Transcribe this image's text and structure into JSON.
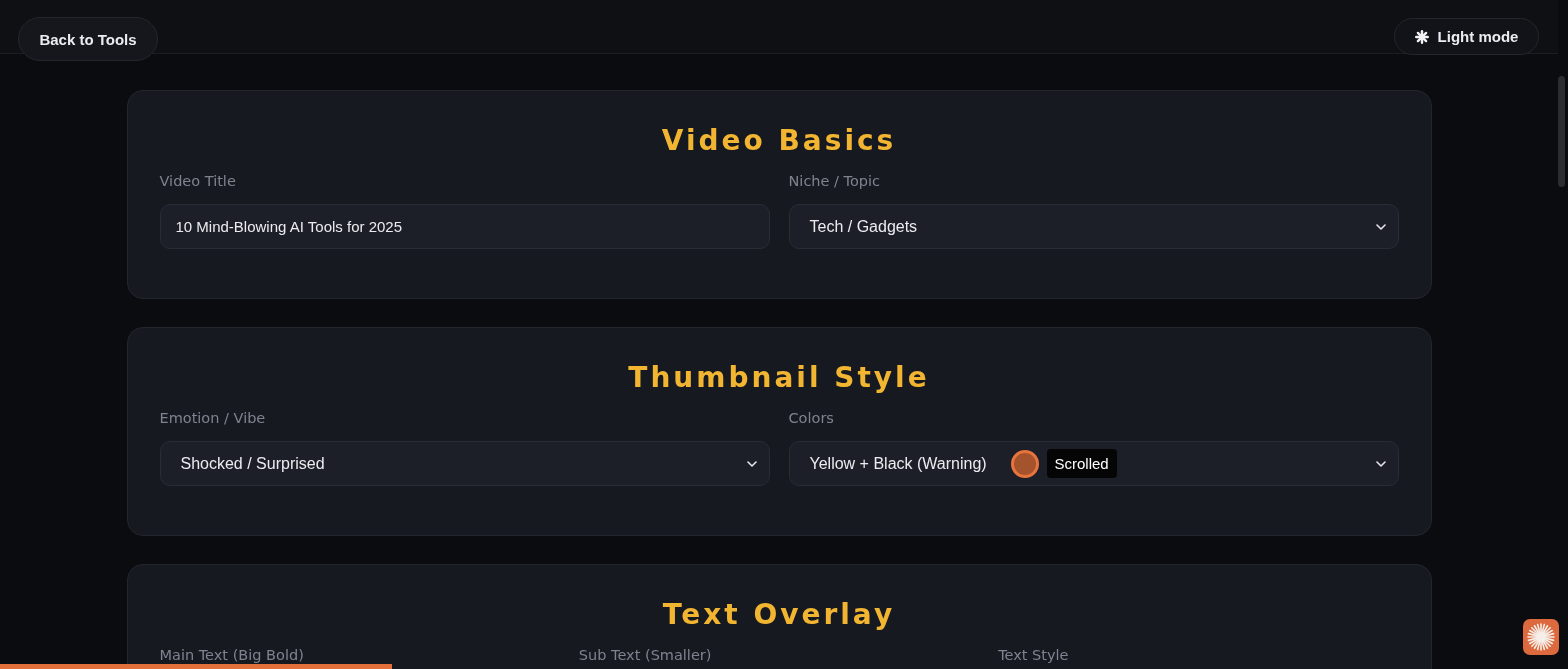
{
  "top_bar": {
    "back_button": "Back to Tools",
    "theme_button": "Light mode"
  },
  "sections": [
    {
      "title": "Video Basics",
      "fields": [
        {
          "kind": "input",
          "label": "Video Title",
          "value": "10 Mind-Blowing AI Tools for 2025"
        },
        {
          "kind": "select",
          "label": "Niche / Topic",
          "value": "Tech / Gadgets"
        }
      ]
    },
    {
      "title": "Thumbnail Style",
      "fields": [
        {
          "kind": "select",
          "label": "Emotion / Vibe",
          "value": "Shocked / Surprised"
        },
        {
          "kind": "select",
          "label": "Colors",
          "value": "Yellow + Black (Warning)",
          "cursor_tooltip": "Scrolled"
        }
      ]
    },
    {
      "title": "Text Overlay",
      "fields": [
        {
          "label": "Main Text (Big Bold)"
        },
        {
          "label": "Sub Text (Smaller)"
        },
        {
          "label": "Text Style"
        }
      ]
    }
  ],
  "scroll_progress": {
    "level": 0.25
  }
}
